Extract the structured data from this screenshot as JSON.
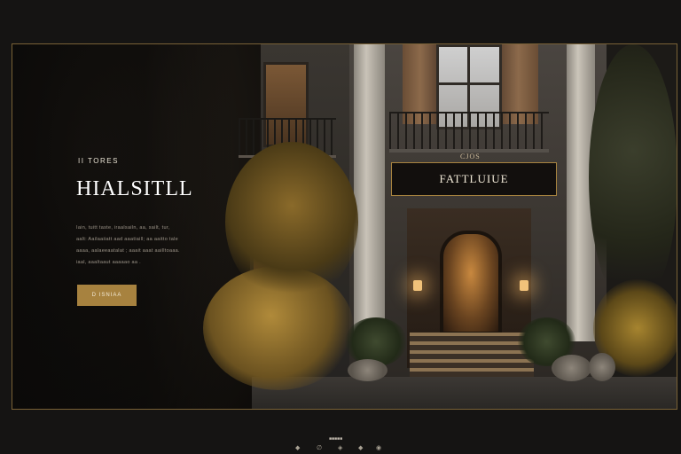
{
  "hero": {
    "eyebrow": "II TORES",
    "title": "HIALSITLL",
    "description": [
      "Iain, tuitt taste, iraalsailn, aa, sailt, tur,",
      "aalt: Aailaaiiatt aad aaatiaill; aa aaitto tale",
      "aaaa, aalaeeaatalat ; aaait aaat aailltoaaa.",
      "iaal, aaaltaaut  aaaaao aa ."
    ],
    "cta_label": "D ISNIAA"
  },
  "sign": {
    "top": "CJOS",
    "label": "FATTLUIUE"
  },
  "footer": {
    "mark": "■■■■■",
    "icons": [
      "◆",
      "∅",
      "◈",
      "◆",
      "◉"
    ]
  },
  "colors": {
    "accent": "#a7823f",
    "frame_border": "#7a6236",
    "background": "#151413"
  }
}
